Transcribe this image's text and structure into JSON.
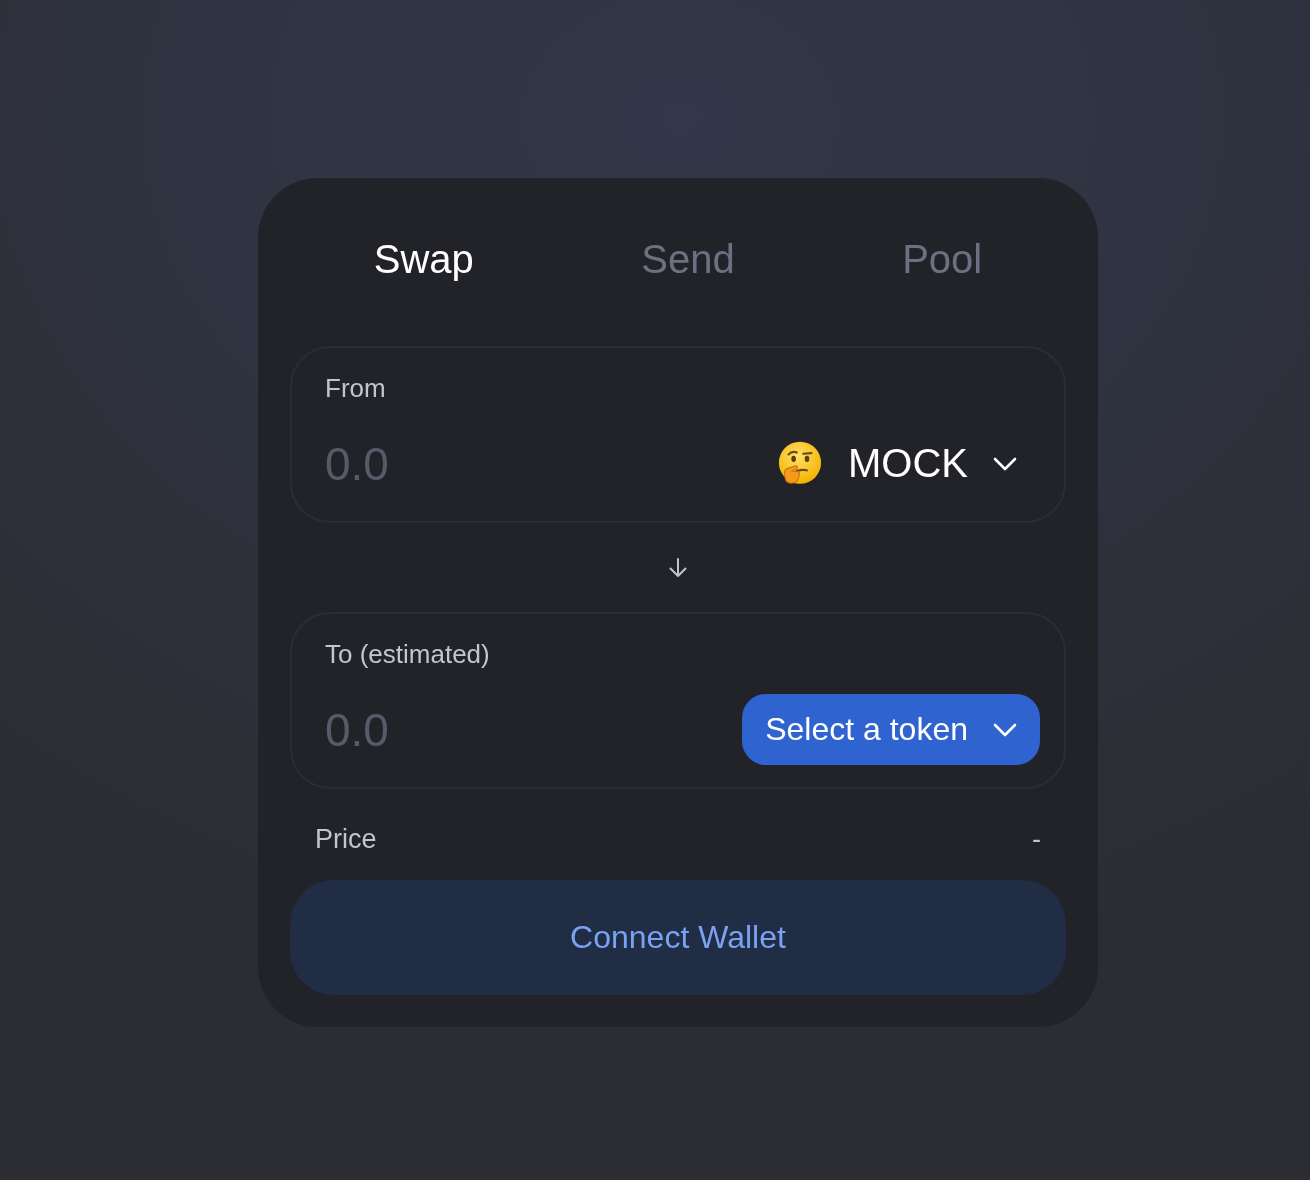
{
  "tabs": [
    {
      "label": "Swap",
      "selected": true
    },
    {
      "label": "Send",
      "selected": false
    },
    {
      "label": "Pool",
      "selected": false
    }
  ],
  "from_panel": {
    "label": "From",
    "amount": {
      "placeholder": "0.0"
    },
    "token": {
      "kind": "chosen",
      "label": "MOCK"
    }
  },
  "to_panel": {
    "label": "To (estimated)",
    "amount": {
      "placeholder": "0.0"
    },
    "token": {
      "kind": "select",
      "label": "Select a token"
    }
  },
  "price": {
    "label": "Price",
    "value": "-"
  },
  "connect_button": {
    "label": "Connect Wallet"
  }
}
